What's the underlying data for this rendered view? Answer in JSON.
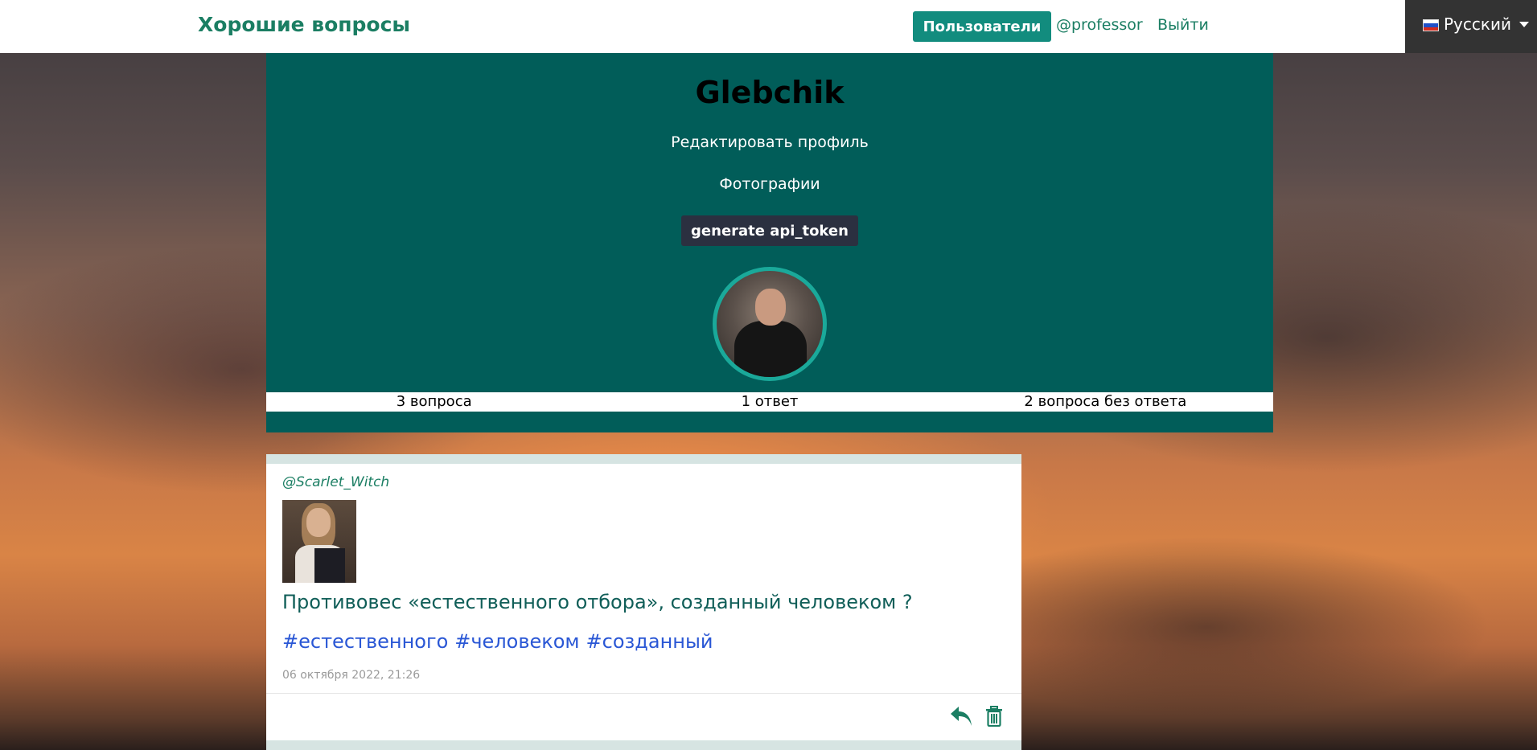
{
  "nav": {
    "brand": "Хорошие вопросы",
    "users_label": "Пользователи",
    "current_user": "@professor",
    "logout_label": "Выйти",
    "language": "Русский"
  },
  "profile": {
    "name": "Glebchik",
    "edit_label": "Редактировать профиль",
    "photos_label": "Фотографии",
    "token_button": "generate api_token",
    "stats": [
      "3 вопроса",
      "1 ответ",
      "2 вопроса без ответа"
    ]
  },
  "question": {
    "author": "@Scarlet_Witch",
    "title": "Противовес «естественного отбора», созданный человеком ?",
    "tags": [
      "#естественного",
      "#человеком",
      "#созданный"
    ],
    "date": "06 октября 2022, 21:26"
  },
  "colors": {
    "accent": "#128c7e",
    "panel": "#015d59",
    "brand": "#1b7e63",
    "tag": "#2a57d5"
  },
  "icons": [
    "reply-icon",
    "trash-icon",
    "caret-down-icon",
    "russian-flag-icon"
  ]
}
